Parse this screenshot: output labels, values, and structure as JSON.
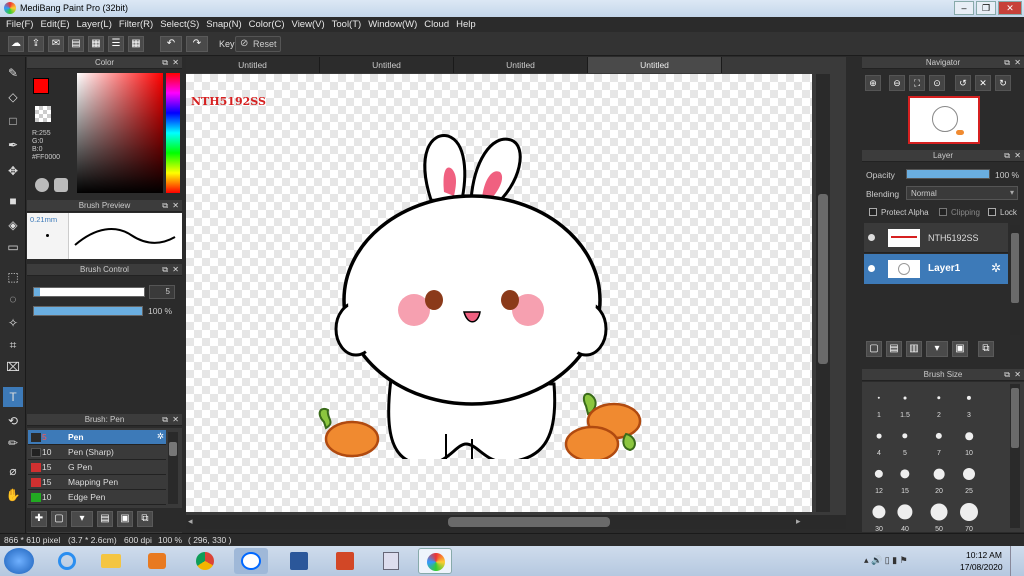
{
  "window": {
    "title": "MediBang Paint Pro (32bit)"
  },
  "menu": [
    "File(F)",
    "Edit(E)",
    "Layer(L)",
    "Filter(R)",
    "Select(S)",
    "Snap(N)",
    "Color(C)",
    "View(V)",
    "Tool(T)",
    "Window(W)",
    "Cloud",
    "Help"
  ],
  "toolbar": {
    "key_label": "Key",
    "reset_label": "Reset"
  },
  "color_panel": {
    "title": "Color",
    "r": "R:255",
    "g": "G:0",
    "b": "B:0",
    "hex": "#FF0000",
    "primary": "#ff0000"
  },
  "brush_preview": {
    "title": "Brush Preview",
    "size": "0.21mm"
  },
  "brush_control": {
    "title": "Brush Control",
    "size_value": "5",
    "opacity_value": "100 %",
    "size_fraction": 0.05,
    "opacity_fraction": 1.0
  },
  "brush_list": {
    "title": "Brush: Pen",
    "items": [
      {
        "size": "5",
        "name": "Pen",
        "color": "#3d7ab8"
      },
      {
        "size": "10",
        "name": "Pen (Sharp)",
        "color": "#2b2b2b"
      },
      {
        "size": "15",
        "name": "G Pen",
        "color": "#d03030"
      },
      {
        "size": "15",
        "name": "Mapping Pen",
        "color": "#d03030"
      },
      {
        "size": "10",
        "name": "Edge Pen",
        "color": "#22aa22"
      }
    ]
  },
  "tabs": [
    "Untitled",
    "Untitled",
    "Untitled",
    "Untitled"
  ],
  "canvas": {
    "watermark": "NTH5192SS"
  },
  "navigator": {
    "title": "Navigator"
  },
  "layer_panel": {
    "title": "Layer",
    "opacity_label": "Opacity",
    "opacity_value": "100 %",
    "blending_label": "Blending",
    "blending_value": "Normal",
    "protect_alpha": "Protect Alpha",
    "clipping": "Clipping",
    "lock": "Lock",
    "layers": [
      {
        "name": "NTH5192SS"
      },
      {
        "name": "Layer1"
      }
    ]
  },
  "brush_size": {
    "title": "Brush Size",
    "rows": [
      [
        "1",
        "1.5",
        "2",
        "3"
      ],
      [
        "4",
        "5",
        "7",
        "10"
      ],
      [
        "12",
        "15",
        "20",
        "25"
      ],
      [
        "30",
        "40",
        "50",
        "70"
      ]
    ]
  },
  "status": {
    "dimensions": "866 * 610 pixel",
    "physical": "(3.7 * 2.6cm)",
    "dpi": "600 dpi",
    "zoom": "100 %",
    "coords": "( 296, 330 )"
  },
  "clock": {
    "time": "10:12 AM",
    "date": "17/08/2020"
  }
}
